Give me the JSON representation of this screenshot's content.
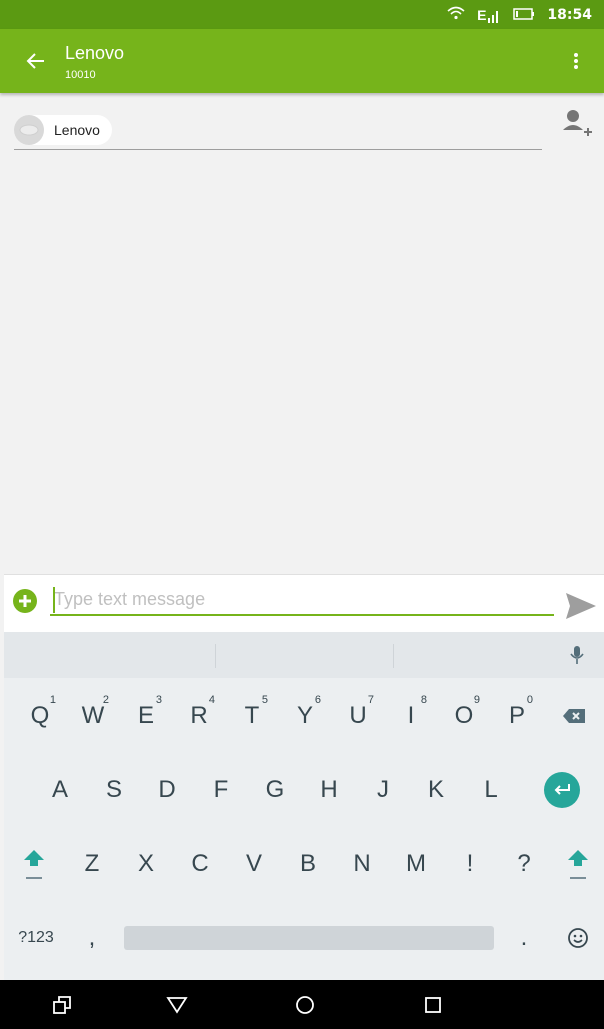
{
  "status_bar": {
    "time": "18:54",
    "network_label": "E",
    "icons": [
      "wifi-icon",
      "signal-icon",
      "battery-icon"
    ]
  },
  "app_bar": {
    "title": "Lenovo",
    "subtitle": "10010",
    "back_icon": "arrow-left-icon",
    "menu_icon": "more-vert-icon"
  },
  "recipient": {
    "chip_label": "Lenovo",
    "add_icon": "add-person-icon"
  },
  "compose": {
    "placeholder": "Type text message",
    "value": "",
    "attach_icon": "add-circle-icon",
    "send_icon": "send-icon"
  },
  "keyboard": {
    "row1": [
      {
        "label": "Q",
        "hint": "1"
      },
      {
        "label": "W",
        "hint": "2"
      },
      {
        "label": "E",
        "hint": "3"
      },
      {
        "label": "R",
        "hint": "4"
      },
      {
        "label": "T",
        "hint": "5"
      },
      {
        "label": "Y",
        "hint": "6"
      },
      {
        "label": "U",
        "hint": "7"
      },
      {
        "label": "I",
        "hint": "8"
      },
      {
        "label": "O",
        "hint": "9"
      },
      {
        "label": "P",
        "hint": "0"
      }
    ],
    "row2": [
      "A",
      "S",
      "D",
      "F",
      "G",
      "H",
      "J",
      "K",
      "L"
    ],
    "row3": [
      "Z",
      "X",
      "C",
      "V",
      "B",
      "N",
      "M",
      "!",
      "?"
    ],
    "symbols_label": "?123",
    "comma": ",",
    "period": ".",
    "icons": [
      "backspace-icon",
      "enter-icon",
      "shift-icon",
      "mic-icon",
      "emoji-icon"
    ]
  },
  "colors": {
    "status_bar": "#5b9a12",
    "app_bar": "#76b41b",
    "accent_green": "#76b41b",
    "enter_key": "#26a69a"
  },
  "nav_bar": {
    "icons": [
      "recent-apps-icon",
      "back-triangle-icon",
      "home-circle-icon",
      "overview-square-icon"
    ]
  }
}
